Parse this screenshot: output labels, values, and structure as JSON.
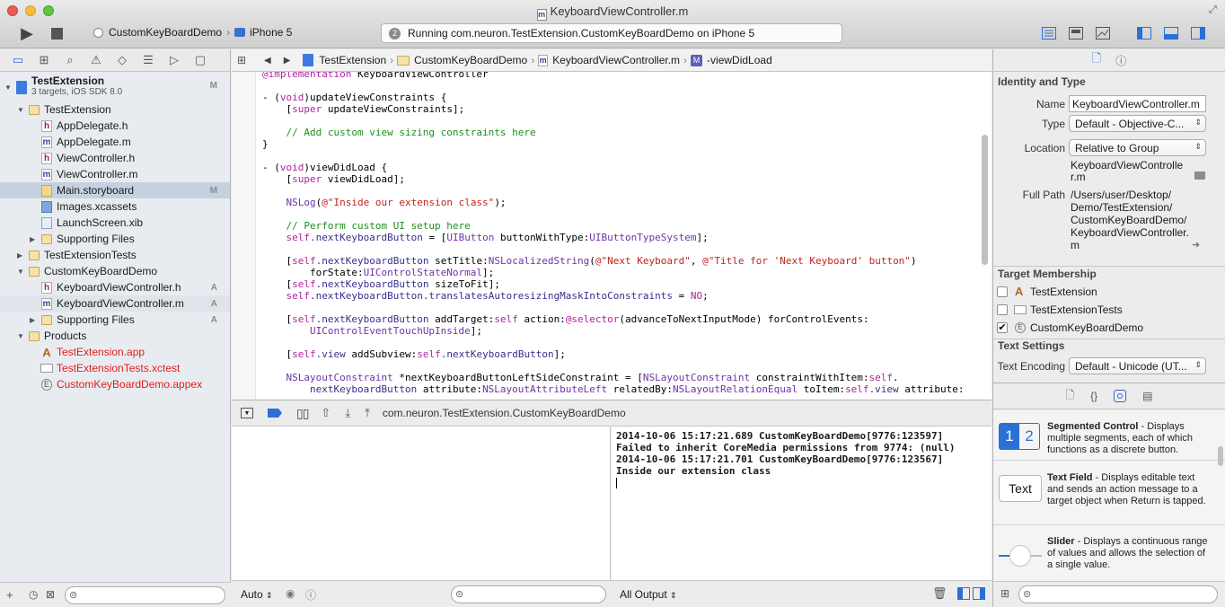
{
  "window": {
    "title": "KeyboardViewController.m"
  },
  "toolbar": {
    "scheme": "CustomKeyBoardDemo",
    "device": "iPhone 5",
    "status_count": "2",
    "status_text": "Running com.neuron.TestExtension.CustomKeyBoardDemo on iPhone 5"
  },
  "navigator": {
    "project": {
      "name": "TestExtension",
      "subtitle": "3 targets, iOS SDK 8.0",
      "mark": "M"
    },
    "items": [
      {
        "label": "TestExtension"
      },
      {
        "label": "AppDelegate.h"
      },
      {
        "label": "AppDelegate.m"
      },
      {
        "label": "ViewController.h"
      },
      {
        "label": "ViewController.m"
      },
      {
        "label": "Main.storyboard",
        "mark": "M"
      },
      {
        "label": "Images.xcassets"
      },
      {
        "label": "LaunchScreen.xib"
      },
      {
        "label": "Supporting Files"
      },
      {
        "label": "TestExtensionTests"
      },
      {
        "label": "CustomKeyBoardDemo"
      },
      {
        "label": "KeyboardViewController.h",
        "mark": "A"
      },
      {
        "label": "KeyboardViewController.m",
        "mark": "A"
      },
      {
        "label": "Supporting Files",
        "mark": "A"
      },
      {
        "label": "Products"
      },
      {
        "label": "TestExtension.app"
      },
      {
        "label": "TestExtensionTests.xctest"
      },
      {
        "label": "CustomKeyBoardDemo.appex"
      }
    ],
    "icon_glyphs": {
      "h": "h",
      "m": "m",
      "appex": "E"
    }
  },
  "jumpbar": {
    "crumbs": [
      "TestExtension",
      "CustomKeyBoardDemo",
      "KeyboardViewController.m",
      "-viewDidLoad"
    ],
    "method_badge": "M"
  },
  "editor": {
    "lines": [
      "@implementation KeyboardViewController",
      "",
      "- (void)updateViewConstraints {",
      "    [super updateViewConstraints];",
      "",
      "    // Add custom view sizing constraints here",
      "}",
      "",
      "- (void)viewDidLoad {",
      "    [super viewDidLoad];",
      "",
      "    NSLog(@\"Inside our extension class\");",
      "",
      "    // Perform custom UI setup here",
      "    self.nextKeyboardButton = [UIButton buttonWithType:UIButtonTypeSystem];",
      "",
      "    [self.nextKeyboardButton setTitle:NSLocalizedString(@\"Next Keyboard\", @\"Title for 'Next Keyboard' button\")",
      "        forState:UIControlStateNormal];",
      "    [self.nextKeyboardButton sizeToFit];",
      "    self.nextKeyboardButton.translatesAutoresizingMaskIntoConstraints = NO;",
      "",
      "    [self.nextKeyboardButton addTarget:self action:@selector(advanceToNextInputMode) forControlEvents:",
      "        UIControlEventTouchUpInside];",
      "",
      "    [self.view addSubview:self.nextKeyboardButton];",
      "",
      "    NSLayoutConstraint *nextKeyboardButtonLeftSideConstraint = [NSLayoutConstraint constraintWithItem:self.",
      "        nextKeyboardButton attribute:NSLayoutAttributeLeft relatedBy:NSLayoutRelationEqual toItem:self.view attribute:"
    ]
  },
  "debug": {
    "target": "com.neuron.TestExtension.CustomKeyBoardDemo",
    "console": "2014-10-06 15:17:21.689 CustomKeyBoardDemo[9776:123597] Failed to inherit CoreMedia permissions from 9774: (null)\n2014-10-06 15:17:21.701 CustomKeyBoardDemo[9776:123567] Inside our extension class",
    "auto_label": "Auto",
    "output_label": "All Output"
  },
  "inspector": {
    "identity_title": "Identity and Type",
    "name_label": "Name",
    "name_value": "KeyboardViewController.m",
    "type_label": "Type",
    "type_value": "Default - Objective-C...",
    "location_label": "Location",
    "location_value": "Relative to Group",
    "location_path": [
      "KeyboardViewControlle",
      "r.m"
    ],
    "fullpath_label": "Full Path",
    "fullpath_lines": [
      "/Users/user/Desktop/",
      "Demo/TestExtension/",
      "CustomKeyBoardDemo/",
      "KeyboardViewController.",
      "m"
    ],
    "membership_title": "Target Membership",
    "targets": [
      {
        "name": "TestExtension",
        "checked": false
      },
      {
        "name": "TestExtensionTests",
        "checked": false
      },
      {
        "name": "CustomKeyBoardDemo",
        "checked": true
      }
    ],
    "textsettings_title": "Text Settings",
    "encoding_label": "Text Encoding",
    "encoding_value": "Default - Unicode (UT...",
    "library": [
      {
        "title": "Segmented Control",
        "desc": " - Displays multiple segments, each of which functions as a discrete button.",
        "icon_text": [
          "1",
          "2"
        ]
      },
      {
        "title": "Text Field",
        "desc": " - Displays editable text and sends an action message to a target object when Return is tapped.",
        "icon_text": "Text"
      },
      {
        "title": "Slider",
        "desc": " - Displays a continuous range of values and allows the selection of a single value."
      }
    ]
  },
  "colors": {
    "selection": "#cbd5e3",
    "accent": "#2c6fd6",
    "product_red": "#e01e1e"
  }
}
